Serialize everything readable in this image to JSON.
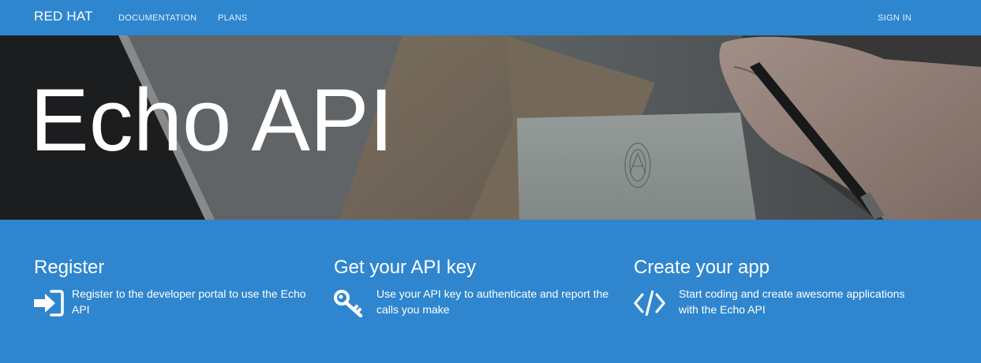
{
  "navbar": {
    "brand": "RED HAT",
    "links": [
      "DOCUMENTATION",
      "PLANS"
    ],
    "signin": "SIGN IN"
  },
  "hero": {
    "title": "Echo API"
  },
  "features": [
    {
      "title": "Register",
      "text": "Register to the developer portal to use the Echo API",
      "icon": "sign-in-icon"
    },
    {
      "title": "Get your API key",
      "text": "Use your API key to authenticate and report the calls you make",
      "icon": "key-icon"
    },
    {
      "title": "Create your app",
      "text": "Start coding and create awesome applications with the Echo API",
      "icon": "code-icon"
    }
  ],
  "colors": {
    "primary": "#2f86cf",
    "text": "#ffffff"
  }
}
